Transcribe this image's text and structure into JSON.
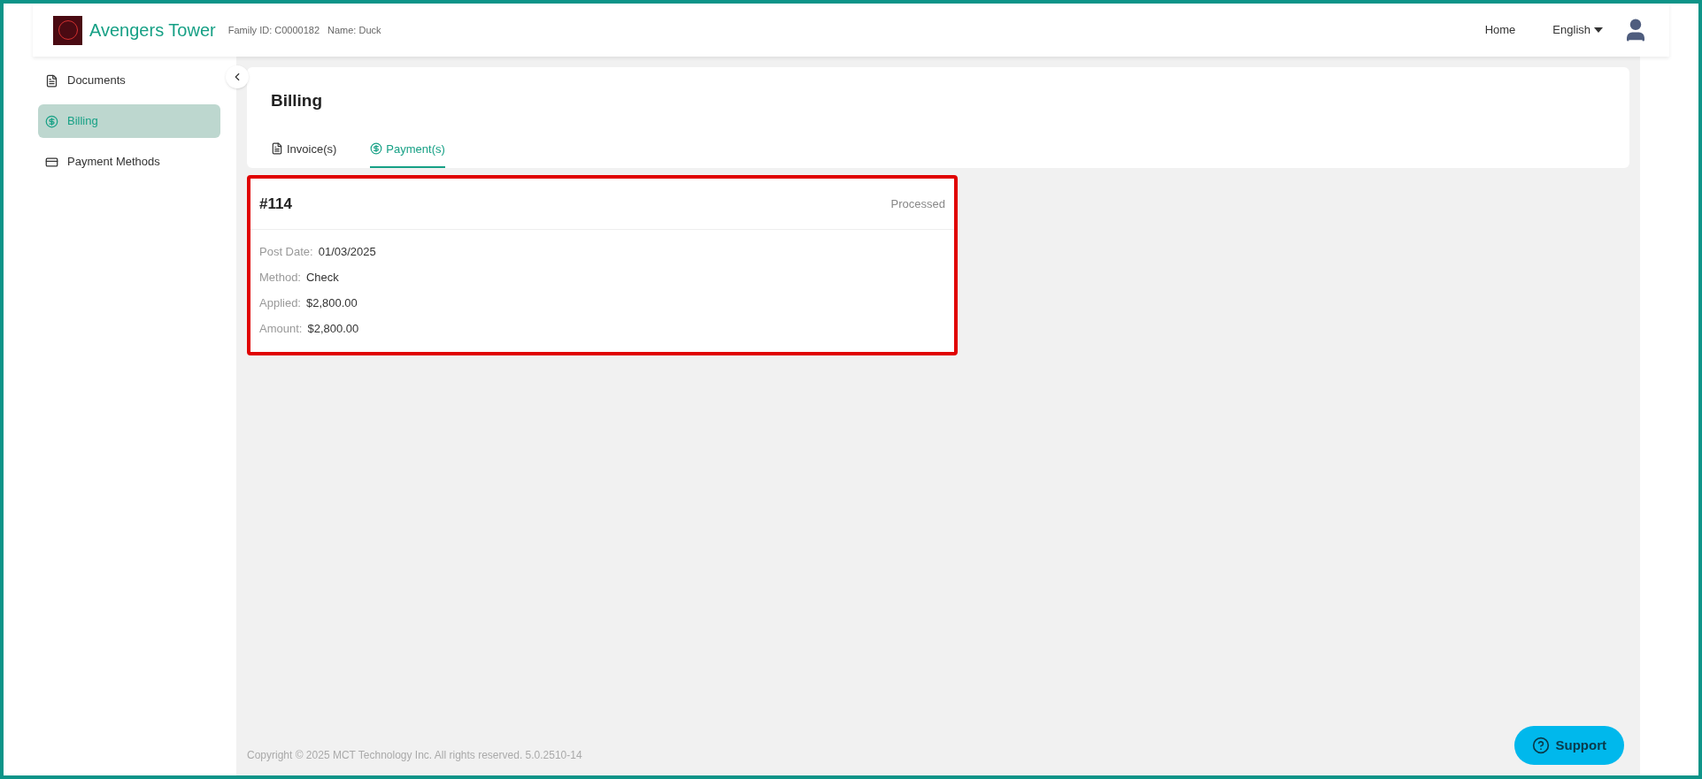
{
  "header": {
    "site_name": "Avengers Tower",
    "family_id": "Family ID: C0000182",
    "name": "Name: Duck",
    "nav": [
      "Home"
    ],
    "language": "English"
  },
  "sidebar": {
    "items": [
      {
        "label": "Documents",
        "kind": "document",
        "selected": false
      },
      {
        "label": "Billing",
        "kind": "dollar",
        "selected": true
      },
      {
        "label": "Payment Methods",
        "kind": "card",
        "selected": false
      }
    ]
  },
  "page": {
    "title": "Billing",
    "tabs": [
      {
        "label": "Invoice(s)",
        "kind": "document",
        "selected": false
      },
      {
        "label": "Payment(s)",
        "kind": "dollar",
        "selected": true
      }
    ]
  },
  "payments": [
    {
      "number": "#114",
      "status": "Processed",
      "highlighted": true,
      "fields": [
        {
          "label": "Post Date:",
          "value": "01/03/2025"
        },
        {
          "label": "Method:",
          "value": "Check"
        },
        {
          "label": "Applied:",
          "value": "$2,800.00"
        },
        {
          "label": "Amount:",
          "value": "$2,800.00"
        }
      ]
    }
  ],
  "footer": "Copyright © 2025 MCT Technology Inc. All rights reserved. 5.0.2510-14",
  "support_button": "Support"
}
